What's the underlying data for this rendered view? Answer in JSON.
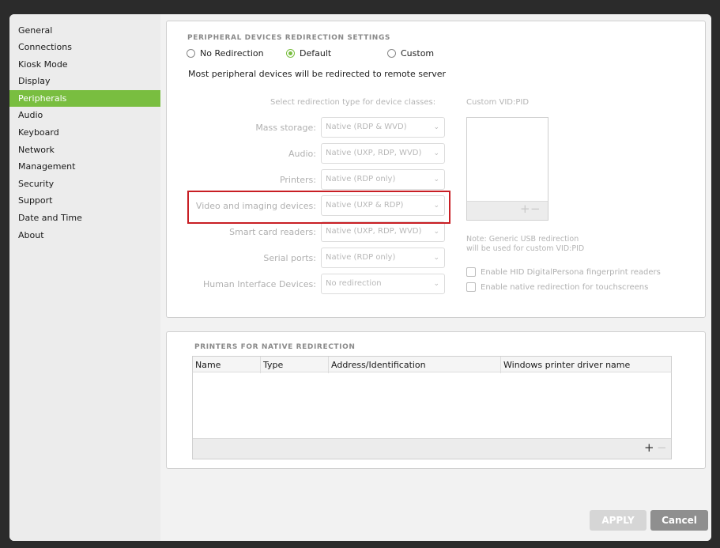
{
  "sidebar": {
    "items": [
      {
        "label": "General"
      },
      {
        "label": "Connections"
      },
      {
        "label": "Kiosk Mode"
      },
      {
        "label": "Display"
      },
      {
        "label": "Peripherals",
        "active": true
      },
      {
        "label": "Audio"
      },
      {
        "label": "Keyboard"
      },
      {
        "label": "Network"
      },
      {
        "label": "Management"
      },
      {
        "label": "Security"
      },
      {
        "label": "Support"
      },
      {
        "label": "Date and Time"
      },
      {
        "label": "About"
      }
    ]
  },
  "redirection": {
    "title": "PERIPHERAL DEVICES REDIRECTION SETTINGS",
    "options": {
      "none": "No Redirection",
      "default": "Default",
      "custom": "Custom"
    },
    "selected": "Default",
    "description": "Most peripheral devices will be redirected to remote server",
    "class_header": "Select redirection type for device classes:",
    "custom_vid_label": "Custom  VID:PID",
    "rows": [
      {
        "label": "Mass storage:",
        "value": "Native (RDP & WVD)"
      },
      {
        "label": "Audio:",
        "value": "Native (UXP, RDP, WVD)"
      },
      {
        "label": "Printers:",
        "value": "Native (RDP only)"
      },
      {
        "label": "Video and imaging devices:",
        "value": "Native (UXP & RDP)"
      },
      {
        "label": "Smart card readers:",
        "value": "Native (UXP, RDP, WVD)"
      },
      {
        "label": "Serial ports:",
        "value": "Native (RDP only)"
      },
      {
        "label": "Human Interface Devices:",
        "value": "No redirection"
      }
    ],
    "note_line1": "Note: Generic USB redirection",
    "note_line2": "will be used for custom VID:PID",
    "checkbox_hid": "Enable HID DigitalPersona fingerprint readers",
    "checkbox_touch": "Enable native redirection for touchscreens",
    "highlight_color": "#c81e24"
  },
  "printers": {
    "title": "PRINTERS FOR NATIVE REDIRECTION",
    "columns": [
      "Name",
      "Type",
      "Address/Identification",
      "Windows printer driver name"
    ],
    "rows": []
  },
  "footer": {
    "apply_label": "APPLY",
    "cancel_label": "Cancel"
  },
  "colors": {
    "accent": "#79be40",
    "apply_disabled": "#d6d6d6",
    "cancel": "#8f8f8f"
  }
}
